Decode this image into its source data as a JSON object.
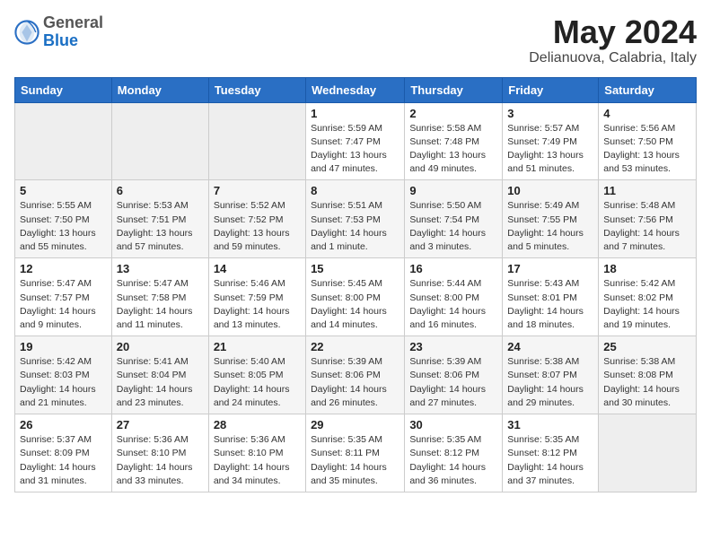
{
  "header": {
    "logo_general": "General",
    "logo_blue": "Blue",
    "month_year": "May 2024",
    "location": "Delianuova, Calabria, Italy"
  },
  "days_of_week": [
    "Sunday",
    "Monday",
    "Tuesday",
    "Wednesday",
    "Thursday",
    "Friday",
    "Saturday"
  ],
  "weeks": [
    [
      {
        "day": "",
        "info": ""
      },
      {
        "day": "",
        "info": ""
      },
      {
        "day": "",
        "info": ""
      },
      {
        "day": "1",
        "info": "Sunrise: 5:59 AM\nSunset: 7:47 PM\nDaylight: 13 hours\nand 47 minutes."
      },
      {
        "day": "2",
        "info": "Sunrise: 5:58 AM\nSunset: 7:48 PM\nDaylight: 13 hours\nand 49 minutes."
      },
      {
        "day": "3",
        "info": "Sunrise: 5:57 AM\nSunset: 7:49 PM\nDaylight: 13 hours\nand 51 minutes."
      },
      {
        "day": "4",
        "info": "Sunrise: 5:56 AM\nSunset: 7:50 PM\nDaylight: 13 hours\nand 53 minutes."
      }
    ],
    [
      {
        "day": "5",
        "info": "Sunrise: 5:55 AM\nSunset: 7:50 PM\nDaylight: 13 hours\nand 55 minutes."
      },
      {
        "day": "6",
        "info": "Sunrise: 5:53 AM\nSunset: 7:51 PM\nDaylight: 13 hours\nand 57 minutes."
      },
      {
        "day": "7",
        "info": "Sunrise: 5:52 AM\nSunset: 7:52 PM\nDaylight: 13 hours\nand 59 minutes."
      },
      {
        "day": "8",
        "info": "Sunrise: 5:51 AM\nSunset: 7:53 PM\nDaylight: 14 hours\nand 1 minute."
      },
      {
        "day": "9",
        "info": "Sunrise: 5:50 AM\nSunset: 7:54 PM\nDaylight: 14 hours\nand 3 minutes."
      },
      {
        "day": "10",
        "info": "Sunrise: 5:49 AM\nSunset: 7:55 PM\nDaylight: 14 hours\nand 5 minutes."
      },
      {
        "day": "11",
        "info": "Sunrise: 5:48 AM\nSunset: 7:56 PM\nDaylight: 14 hours\nand 7 minutes."
      }
    ],
    [
      {
        "day": "12",
        "info": "Sunrise: 5:47 AM\nSunset: 7:57 PM\nDaylight: 14 hours\nand 9 minutes."
      },
      {
        "day": "13",
        "info": "Sunrise: 5:47 AM\nSunset: 7:58 PM\nDaylight: 14 hours\nand 11 minutes."
      },
      {
        "day": "14",
        "info": "Sunrise: 5:46 AM\nSunset: 7:59 PM\nDaylight: 14 hours\nand 13 minutes."
      },
      {
        "day": "15",
        "info": "Sunrise: 5:45 AM\nSunset: 8:00 PM\nDaylight: 14 hours\nand 14 minutes."
      },
      {
        "day": "16",
        "info": "Sunrise: 5:44 AM\nSunset: 8:00 PM\nDaylight: 14 hours\nand 16 minutes."
      },
      {
        "day": "17",
        "info": "Sunrise: 5:43 AM\nSunset: 8:01 PM\nDaylight: 14 hours\nand 18 minutes."
      },
      {
        "day": "18",
        "info": "Sunrise: 5:42 AM\nSunset: 8:02 PM\nDaylight: 14 hours\nand 19 minutes."
      }
    ],
    [
      {
        "day": "19",
        "info": "Sunrise: 5:42 AM\nSunset: 8:03 PM\nDaylight: 14 hours\nand 21 minutes."
      },
      {
        "day": "20",
        "info": "Sunrise: 5:41 AM\nSunset: 8:04 PM\nDaylight: 14 hours\nand 23 minutes."
      },
      {
        "day": "21",
        "info": "Sunrise: 5:40 AM\nSunset: 8:05 PM\nDaylight: 14 hours\nand 24 minutes."
      },
      {
        "day": "22",
        "info": "Sunrise: 5:39 AM\nSunset: 8:06 PM\nDaylight: 14 hours\nand 26 minutes."
      },
      {
        "day": "23",
        "info": "Sunrise: 5:39 AM\nSunset: 8:06 PM\nDaylight: 14 hours\nand 27 minutes."
      },
      {
        "day": "24",
        "info": "Sunrise: 5:38 AM\nSunset: 8:07 PM\nDaylight: 14 hours\nand 29 minutes."
      },
      {
        "day": "25",
        "info": "Sunrise: 5:38 AM\nSunset: 8:08 PM\nDaylight: 14 hours\nand 30 minutes."
      }
    ],
    [
      {
        "day": "26",
        "info": "Sunrise: 5:37 AM\nSunset: 8:09 PM\nDaylight: 14 hours\nand 31 minutes."
      },
      {
        "day": "27",
        "info": "Sunrise: 5:36 AM\nSunset: 8:10 PM\nDaylight: 14 hours\nand 33 minutes."
      },
      {
        "day": "28",
        "info": "Sunrise: 5:36 AM\nSunset: 8:10 PM\nDaylight: 14 hours\nand 34 minutes."
      },
      {
        "day": "29",
        "info": "Sunrise: 5:35 AM\nSunset: 8:11 PM\nDaylight: 14 hours\nand 35 minutes."
      },
      {
        "day": "30",
        "info": "Sunrise: 5:35 AM\nSunset: 8:12 PM\nDaylight: 14 hours\nand 36 minutes."
      },
      {
        "day": "31",
        "info": "Sunrise: 5:35 AM\nSunset: 8:12 PM\nDaylight: 14 hours\nand 37 minutes."
      },
      {
        "day": "",
        "info": ""
      }
    ]
  ]
}
